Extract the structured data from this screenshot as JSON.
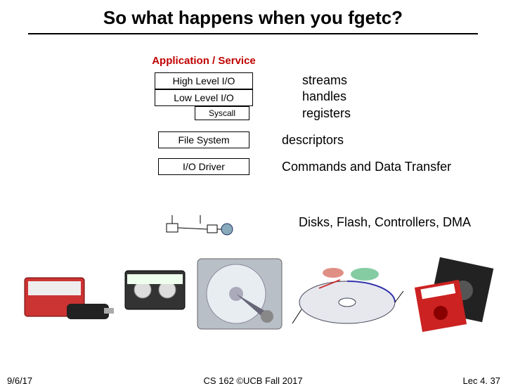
{
  "title": "So what happens when you fgetc?",
  "stack": {
    "app_service": "Application / Service",
    "high_level": "High Level I/O",
    "low_level": "Low Level I/O",
    "syscall": "Syscall",
    "file_system": "File System",
    "io_driver": "I/O Driver"
  },
  "labels": {
    "streams": "streams",
    "handles": "handles",
    "registers": "registers",
    "descriptors": "descriptors",
    "commands": "Commands and Data Transfer",
    "hardware": "Disks, Flash, Controllers, DMA"
  },
  "images": {
    "ssd": "SSD drive & USB stick",
    "tape": "cassette tape",
    "hdd": "open hard disk",
    "diagram": "platter geometry diagram",
    "floppy": "floppy disks"
  },
  "footer": {
    "date": "9/6/17",
    "center": "CS 162 ©UCB Fall 2017",
    "right": "Lec 4. 37"
  }
}
